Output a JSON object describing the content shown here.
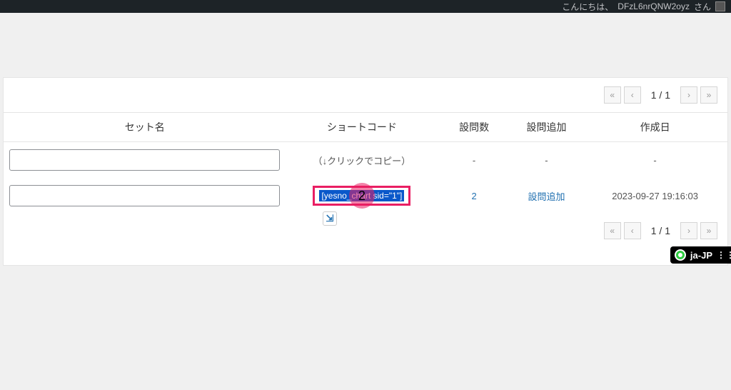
{
  "adminbar": {
    "greeting_prefix": "こんにちは、",
    "username": "DFzL6nrQNW2oyz",
    "greeting_suffix": " さん"
  },
  "pagination": {
    "first": "«",
    "prev": "‹",
    "indicator": "1 / 1",
    "next": "›",
    "last": "»"
  },
  "table": {
    "headers": {
      "set_name": "セット名",
      "shortcode": "ショートコード",
      "question_count": "設問数",
      "question_add": "設問追加",
      "created": "作成日"
    },
    "hint_row": {
      "shortcode_hint": "（↓クリックでコピー）",
      "dash": "-"
    },
    "data_row": {
      "set_value": "",
      "shortcode_text": "[yesno_chart sid=\"1\"]",
      "count": "2",
      "add_label": "設問追加",
      "created": "2023-09-27 19:16:03"
    }
  },
  "annotation": {
    "step_number": "2"
  },
  "floating": {
    "copy_glyph": "⇲"
  },
  "locale": {
    "label": "ja-JP"
  }
}
